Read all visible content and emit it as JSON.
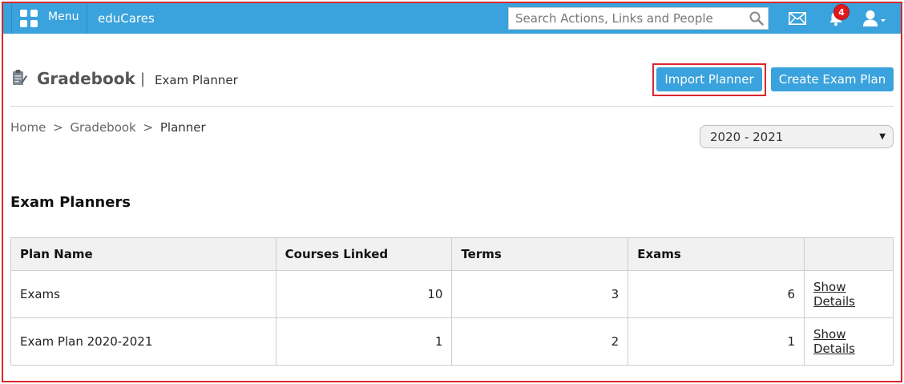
{
  "topbar": {
    "menu_label": "Menu",
    "app_name": "eduCares",
    "search_placeholder": "Search Actions, Links and People",
    "notification_count": "4",
    "colors": {
      "bar": "#3aa2dc",
      "badge": "#e0191f"
    }
  },
  "header": {
    "title": "Gradebook",
    "separator": "|",
    "subtitle": "Exam Planner",
    "import_button": "Import Planner",
    "create_button": "Create Exam Plan"
  },
  "breadcrumb": {
    "items": [
      "Home",
      "Gradebook",
      "Planner"
    ],
    "separator": ">"
  },
  "year_select": {
    "value": "2020 - 2021"
  },
  "section_title": "Exam Planners",
  "table": {
    "columns": [
      "Plan Name",
      "Courses Linked",
      "Terms",
      "Exams",
      ""
    ],
    "rows": [
      {
        "plan_name": "Exams",
        "courses_linked": "10",
        "terms": "3",
        "exams": "6",
        "action": "Show Details"
      },
      {
        "plan_name": "Exam Plan 2020-2021",
        "courses_linked": "1",
        "terms": "2",
        "exams": "1",
        "action": "Show Details"
      }
    ]
  }
}
